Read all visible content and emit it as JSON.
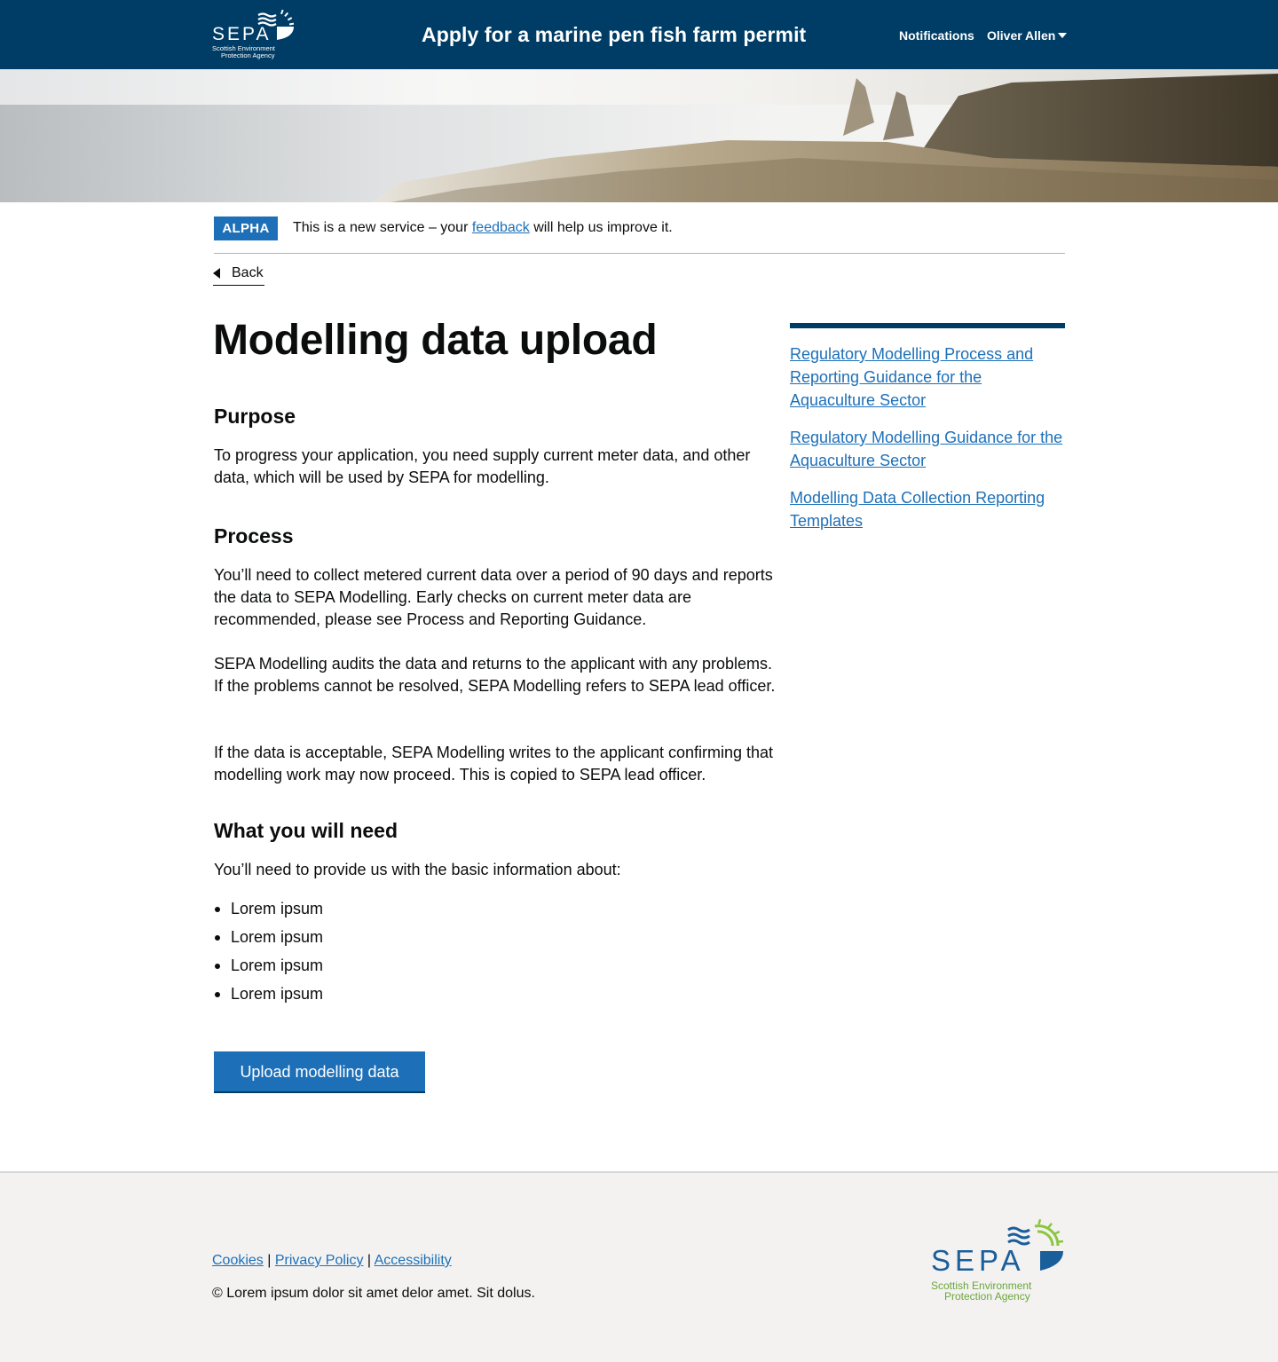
{
  "header": {
    "logo_text": "SEPA",
    "logo_sub1": "Scottish Environment",
    "logo_sub2": "Protection Agency",
    "service_title": "Apply for a marine pen fish farm permit",
    "nav": {
      "notifications": "Notifications",
      "user": "Oliver Allen"
    }
  },
  "phase_banner": {
    "tag": "ALPHA",
    "text_before": "This is a new service – your ",
    "link": "feedback",
    "text_after": " will help us improve it."
  },
  "back_link": "Back",
  "main": {
    "title": "Modelling data upload",
    "purpose_heading": "Purpose",
    "purpose_text": "To progress your application, you need supply current meter data, and other data, which will be used by SEPA for modelling.",
    "process_heading": "Process",
    "process_p1": "You’ll need to collect metered current data over a period of 90 days and reports the data to SEPA Modelling. Early checks on current meter data are recommended, please see Process and Reporting Guidance.",
    "process_p2": "SEPA Modelling audits the data and returns to the applicant with any problems. If the problems cannot be resolved, SEPA Modelling refers to SEPA lead officer.",
    "process_p3": "If the data is acceptable, SEPA Modelling writes to the applicant confirming that modelling work may now proceed. This is copied to SEPA lead officer.",
    "need_heading": "What you will need",
    "need_intro": "You’ll need to provide us with the basic information about:",
    "need_items": [
      "Lorem ipsum",
      "Lorem ipsum",
      "Lorem ipsum",
      "Lorem ipsum"
    ],
    "upload_button": "Upload modelling data"
  },
  "sidebar": {
    "links": [
      "Regulatory Modelling Process and Reporting Guidance for the Aquaculture Sector",
      "Regulatory Modelling Guidance for the Aquaculture Sector",
      "Modelling Data Collection Reporting Templates"
    ]
  },
  "footer": {
    "links": [
      "Cookies",
      "Privacy Policy",
      "Accessibility"
    ],
    "separator": "|",
    "copyright": "© Lorem ipsum dolor sit amet delor amet. Sit dolus.",
    "logo_text": "SEPA",
    "logo_sub1": "Scottish Environment",
    "logo_sub2": "Protection Agency"
  },
  "colors": {
    "header_bg": "#003d66",
    "link": "#1d70b8",
    "button": "#1d70b8",
    "footer_bg": "#f3f2f1",
    "logo_green": "#8cc63f"
  }
}
